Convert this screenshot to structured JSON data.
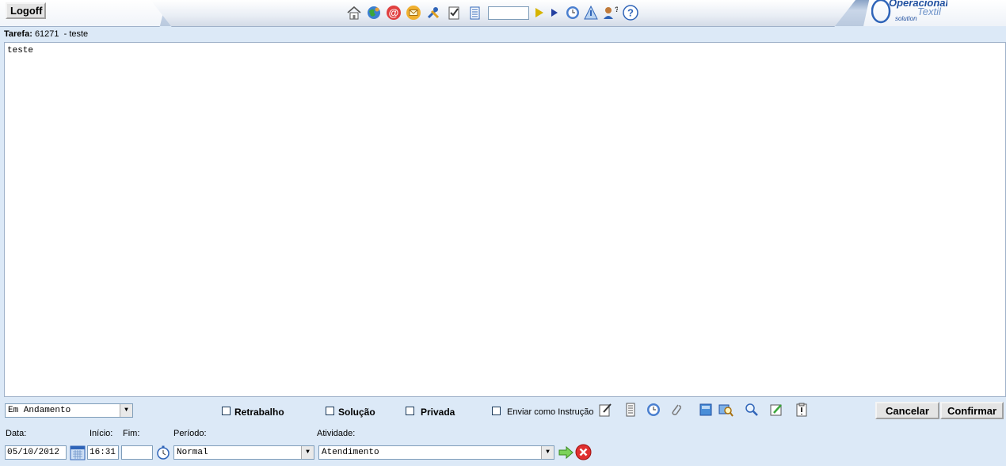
{
  "header": {
    "logoff_label": "Logoff",
    "logo_text_top": "Operacional",
    "logo_text_bottom": "Textil",
    "logo_text_sub": "solution",
    "toolbar_icons": [
      "home-icon",
      "globe-icon",
      "email-at-icon",
      "envelope-icon",
      "tools-icon",
      "checklist-icon",
      "list-icon",
      "go-arrow-icon",
      "next-arrow-icon",
      "clock-icon",
      "triangle-tool-icon",
      "user-help-icon",
      "help-icon"
    ],
    "quick_search_value": ""
  },
  "task": {
    "label": "Tarefa:",
    "number": "61271",
    "title": "- teste"
  },
  "editor": {
    "content": "teste"
  },
  "form": {
    "status_value": "Em Andamento",
    "checkboxes": [
      {
        "label": "Retrabalho",
        "checked": false
      },
      {
        "label": "Solução",
        "checked": false
      },
      {
        "label": "Privada",
        "checked": false
      },
      {
        "label": "Enviar como Instrução",
        "checked": false
      }
    ],
    "cancel_label": "Cancelar",
    "confirm_label": "Confirmar",
    "data_label": "Data:",
    "inicio_label": "Início:",
    "fim_label": "Fim:",
    "periodo_label": "Período:",
    "atividade_label": "Atividade:",
    "data_value": "05/10/2012",
    "inicio_value": "16:31",
    "fim_value": "",
    "periodo_value": "Normal",
    "atividade_value": "Atendimento"
  }
}
